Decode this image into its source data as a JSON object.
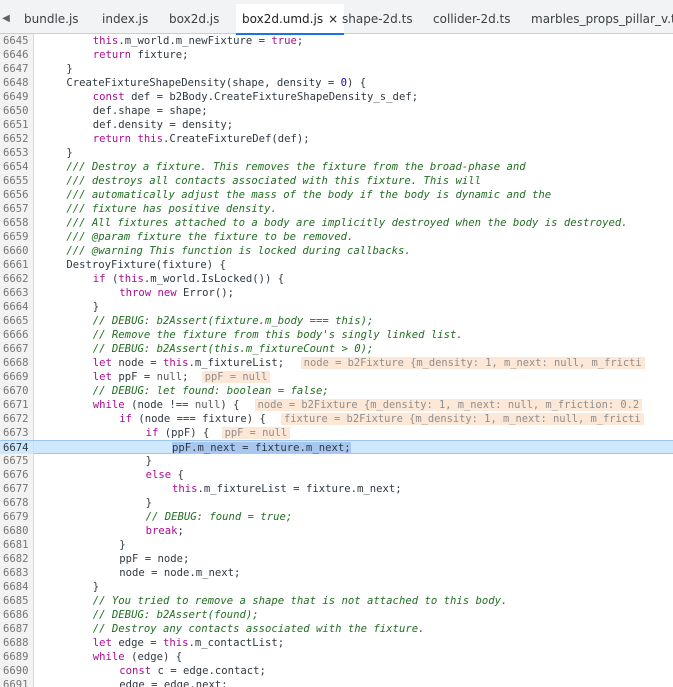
{
  "tabs": [
    {
      "label": "bundle.js",
      "active": false
    },
    {
      "label": "index.js",
      "active": false
    },
    {
      "label": "box2d.js",
      "active": false
    },
    {
      "label": "box2d.umd.js",
      "active": true
    },
    {
      "label": "shape-2d.ts",
      "active": false
    },
    {
      "label": "collider-2d.ts",
      "active": false
    },
    {
      "label": "marbles_props_pillar_v.ts",
      "active": false
    }
  ],
  "tab_close_glyph": "×",
  "tab_scroll_left_glyph": "◀",
  "current_line": "6674",
  "lines": [
    {
      "num": "6645",
      "indent": 8,
      "text": "this.m_world.m_newFixture = true;"
    },
    {
      "num": "6646",
      "indent": 8,
      "text": "return fixture;"
    },
    {
      "num": "6647",
      "indent": 4,
      "text": "}"
    },
    {
      "num": "6648",
      "indent": 4,
      "text": "CreateFixtureShapeDensity(shape, density = 0) {"
    },
    {
      "num": "6649",
      "indent": 8,
      "text": "const def = b2Body.CreateFixtureShapeDensity_s_def;"
    },
    {
      "num": "6650",
      "indent": 8,
      "text": "def.shape = shape;"
    },
    {
      "num": "6651",
      "indent": 8,
      "text": "def.density = density;"
    },
    {
      "num": "6652",
      "indent": 8,
      "text": "return this.CreateFixtureDef(def);"
    },
    {
      "num": "6653",
      "indent": 4,
      "text": "}"
    },
    {
      "num": "6654",
      "indent": 4,
      "text": "/// Destroy a fixture. This removes the fixture from the broad-phase and"
    },
    {
      "num": "6655",
      "indent": 4,
      "text": "/// destroys all contacts associated with this fixture. This will"
    },
    {
      "num": "6656",
      "indent": 4,
      "text": "/// automatically adjust the mass of the body if the body is dynamic and the"
    },
    {
      "num": "6657",
      "indent": 4,
      "text": "/// fixture has positive density."
    },
    {
      "num": "6658",
      "indent": 4,
      "text": "/// All fixtures attached to a body are implicitly destroyed when the body is destroyed."
    },
    {
      "num": "6659",
      "indent": 4,
      "text": "/// @param fixture the fixture to be removed."
    },
    {
      "num": "6660",
      "indent": 4,
      "text": "/// @warning This function is locked during callbacks."
    },
    {
      "num": "6661",
      "indent": 4,
      "text": "DestroyFixture(fixture) {"
    },
    {
      "num": "6662",
      "indent": 8,
      "text": "if (this.m_world.IsLocked()) {"
    },
    {
      "num": "6663",
      "indent": 12,
      "text": "throw new Error();"
    },
    {
      "num": "6664",
      "indent": 8,
      "text": "}"
    },
    {
      "num": "6665",
      "indent": 8,
      "text": "// DEBUG: b2Assert(fixture.m_body === this);"
    },
    {
      "num": "6666",
      "indent": 8,
      "text": "// Remove the fixture from this body's singly linked list."
    },
    {
      "num": "6667",
      "indent": 8,
      "text": "// DEBUG: b2Assert(this.m_fixtureCount > 0);"
    },
    {
      "num": "6668",
      "indent": 8,
      "text": "let node = this.m_fixtureList;",
      "inline": "node = b2Fixture {m_density: 1, m_next: null, m_fricti"
    },
    {
      "num": "6669",
      "indent": 8,
      "text": "let ppF = null;",
      "inline": "ppF = null"
    },
    {
      "num": "6670",
      "indent": 8,
      "text": "// DEBUG: let found: boolean = false;"
    },
    {
      "num": "6671",
      "indent": 8,
      "text": "while (node !== null) {",
      "inline": "node = b2Fixture {m_density: 1, m_next: null, m_friction: 0.2"
    },
    {
      "num": "6672",
      "indent": 12,
      "text": "if (node === fixture) {",
      "inline": "fixture = b2Fixture {m_density: 1, m_next: null, m_fricti"
    },
    {
      "num": "6673",
      "indent": 16,
      "text": "if (ppF) {",
      "inline": "ppF = null"
    },
    {
      "num": "6674",
      "indent": 20,
      "text": "ppF.m_next = fixture.m_next;"
    },
    {
      "num": "6675",
      "indent": 16,
      "text": "}"
    },
    {
      "num": "6676",
      "indent": 16,
      "text": "else {"
    },
    {
      "num": "6677",
      "indent": 20,
      "text": "this.m_fixtureList = fixture.m_next;"
    },
    {
      "num": "6678",
      "indent": 16,
      "text": "}"
    },
    {
      "num": "6679",
      "indent": 16,
      "text": "// DEBUG: found = true;"
    },
    {
      "num": "6680",
      "indent": 16,
      "text": "break;"
    },
    {
      "num": "6681",
      "indent": 12,
      "text": "}"
    },
    {
      "num": "6682",
      "indent": 12,
      "text": "ppF = node;"
    },
    {
      "num": "6683",
      "indent": 12,
      "text": "node = node.m_next;"
    },
    {
      "num": "6684",
      "indent": 8,
      "text": "}"
    },
    {
      "num": "6685",
      "indent": 8,
      "text": "// You tried to remove a shape that is not attached to this body."
    },
    {
      "num": "6686",
      "indent": 8,
      "text": "// DEBUG: b2Assert(found);"
    },
    {
      "num": "6687",
      "indent": 8,
      "text": "// Destroy any contacts associated with the fixture."
    },
    {
      "num": "6688",
      "indent": 8,
      "text": "let edge = this.m_contactList;"
    },
    {
      "num": "6689",
      "indent": 8,
      "text": "while (edge) {"
    },
    {
      "num": "6690",
      "indent": 12,
      "text": "const c = edge.contact;"
    },
    {
      "num": "6691",
      "indent": 12,
      "text": "edge = edge.next;"
    }
  ]
}
